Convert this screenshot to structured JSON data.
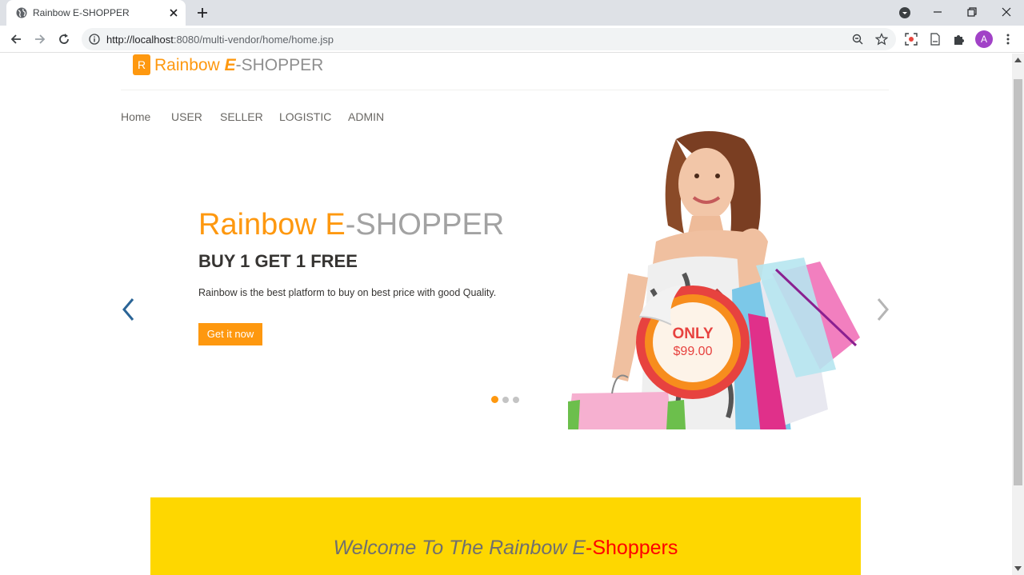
{
  "browser": {
    "tab_title": "Rainbow E-SHOPPER",
    "url_host": "http://localhost",
    "url_path": ":8080/multi-vendor/home/home.jsp",
    "profile_initial": "A"
  },
  "site": {
    "logo_badge": "R",
    "logo_word1": "Rainbow ",
    "logo_e": "E",
    "logo_rest": "-SHOPPER"
  },
  "nav": {
    "items": [
      "Home",
      "USER",
      "SELLER",
      "LOGISTIC",
      "ADMIN"
    ]
  },
  "slider": {
    "title_part1": "Rainbow E",
    "title_part2": "-SHOPPER",
    "subtitle": "BUY 1 GET 1 FREE",
    "description": "Rainbow is the best platform to buy on best price with good Quality.",
    "cta_label": "Get it now",
    "badge_label": "ONLY",
    "badge_price": "$99.00",
    "active_slide": 1,
    "slide_count": 3
  },
  "welcome": {
    "text_part1": "Welcome To The Rainbow E",
    "text_part2": "-Shoppers"
  },
  "colors": {
    "brand_orange": "#fe980f",
    "welcome_yellow": "#fed700",
    "price_red": "#e7423f"
  }
}
